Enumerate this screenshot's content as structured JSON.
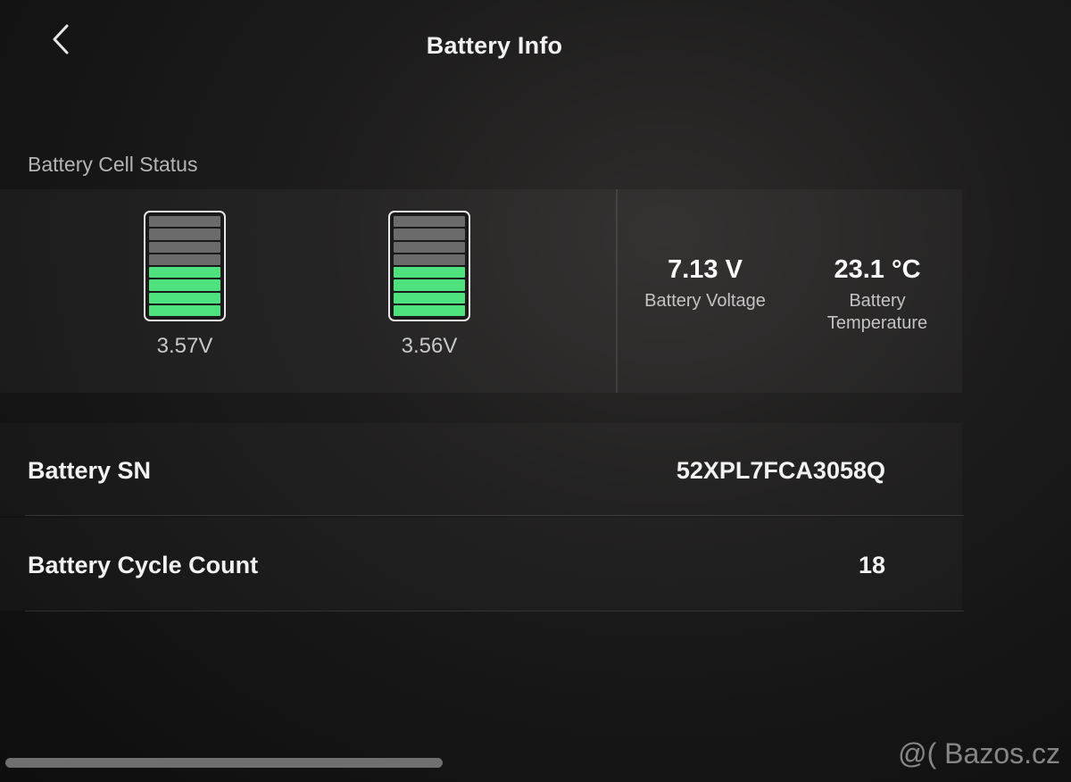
{
  "header": {
    "title": "Battery Info",
    "back_icon": "chevron-left-icon"
  },
  "cell_status": {
    "section_label": "Battery Cell Status",
    "segments_total": 8,
    "cells": [
      {
        "voltage": "3.57V",
        "filled_segments": 4
      },
      {
        "voltage": "3.56V",
        "filled_segments": 4
      }
    ],
    "fill_color": "#4ee27f",
    "empty_color": "#6b6b6b"
  },
  "stats": {
    "voltage": {
      "value": "7.13 V",
      "label": "Battery Voltage"
    },
    "temperature": {
      "value": "23.1 °C",
      "label_line1": "Battery",
      "label_line2": "Temperature"
    }
  },
  "rows": {
    "serial": {
      "label": "Battery SN",
      "value": "52XPL7FCA3058Q"
    },
    "cycle_count": {
      "label": "Battery Cycle Count",
      "value": "18"
    }
  },
  "watermark": "@( Bazos.cz"
}
